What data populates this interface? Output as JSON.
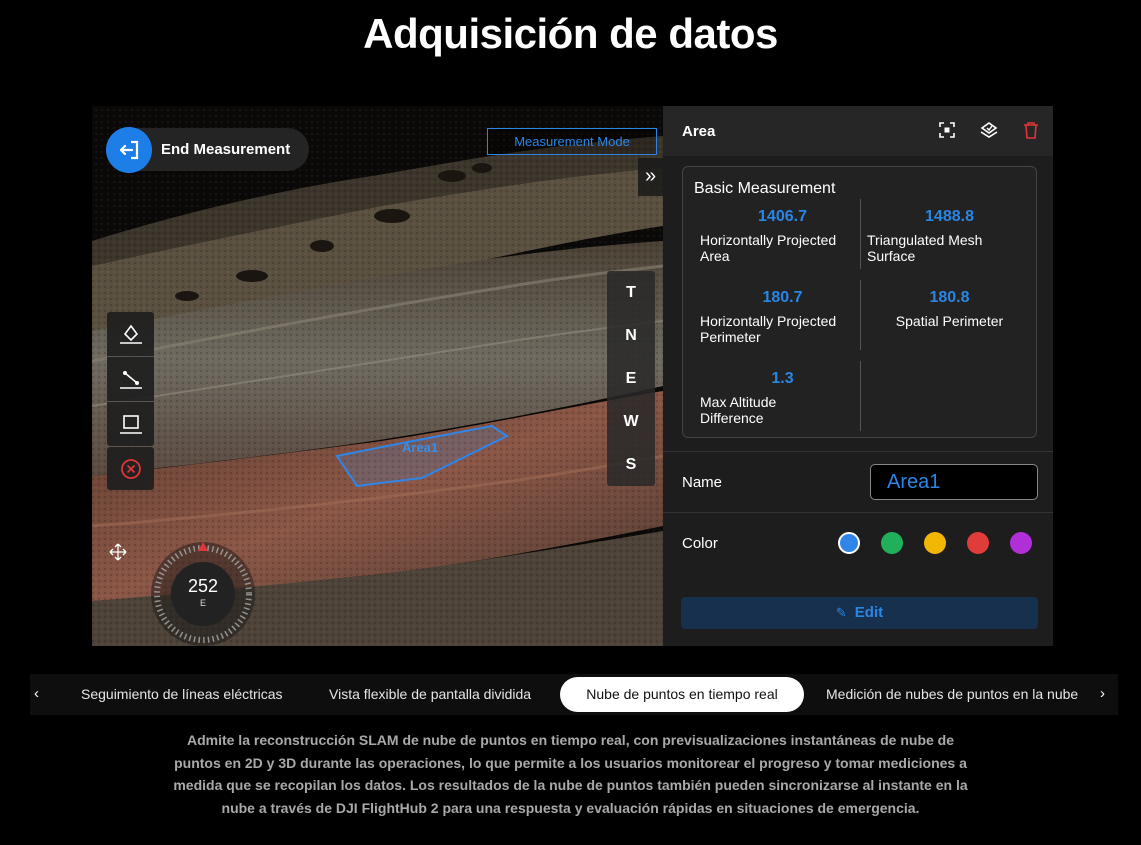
{
  "page": {
    "title": "Adquisición de datos"
  },
  "viewer": {
    "end_button_label": "End Measurement",
    "mode_label": "Measurement Mode",
    "collapse_glyph": "»",
    "view_buttons": [
      "T",
      "N",
      "E",
      "W",
      "S"
    ],
    "area_label": "Area1",
    "compass": {
      "heading": "252",
      "direction": "E"
    },
    "tools": [
      "point-measure-icon",
      "line-measure-icon",
      "area-measure-icon",
      "cancel-icon"
    ]
  },
  "panel": {
    "title": "Area",
    "header_icons": [
      "focus-icon",
      "save-icon",
      "delete-icon"
    ],
    "basic_measurement": {
      "title": "Basic Measurement",
      "metrics": [
        {
          "value": "1406.7",
          "label_line1": "Horizontally Projected",
          "label_line2": "Area"
        },
        {
          "value": "1488.8",
          "label_line1": "Triangulated Mesh",
          "label_line2": "Surface"
        },
        {
          "value": "180.7",
          "label_line1": "Horizontally Projected",
          "label_line2": "Perimeter"
        },
        {
          "value": "180.8",
          "label_line1": "Spatial Perimeter",
          "label_line2": ""
        },
        {
          "value": "1.3",
          "label_line1": "Max Altitude",
          "label_line2": "Difference"
        }
      ]
    },
    "name_label": "Name",
    "name_value": "Area1",
    "color_label": "Color",
    "colors": [
      "#2f86e8",
      "#21b05a",
      "#f2b705",
      "#e03c3a",
      "#b12fd8"
    ],
    "selected_color": "#2f86e8",
    "edit_label": "Edit"
  },
  "tabs": {
    "items": [
      "Seguimiento de líneas eléctricas",
      "Vista flexible de pantalla dividida",
      "Nube de puntos en tiempo real",
      "Medición de nubes de puntos en la nube"
    ],
    "active_index": 2,
    "prev_glyph": "‹",
    "next_glyph": "›"
  },
  "description": "Admite la reconstrucción SLAM de nube de puntos en tiempo real, con previsualizaciones instantáneas de nube de puntos en 2D y 3D durante las operaciones, lo que permite a los usuarios monitorear el progreso y tomar mediciones a medida que se recopilan los datos. Los resultados de la nube de puntos también pueden sincronizarse al instante en la nube a través de DJI FlightHub 2 para una respuesta y evaluación rápidas en situaciones de emergencia."
}
